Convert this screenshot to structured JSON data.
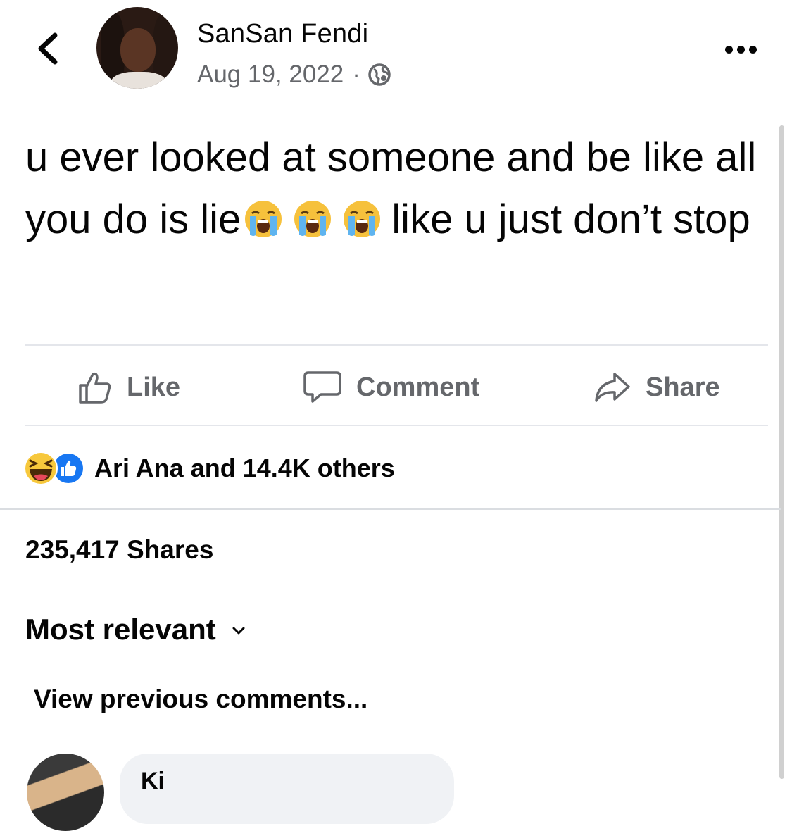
{
  "header": {
    "back_icon": "chevron-left-icon",
    "author_name": "SanSan Fendi",
    "date": "Aug 19, 2022",
    "separator": "·",
    "privacy_icon": "globe-icon",
    "more_icon": "more-horizontal-icon"
  },
  "post": {
    "text_part1": "u ever looked at someone and be like all you do is lie",
    "emojis": [
      "loudly-crying-face",
      "loudly-crying-face",
      "loudly-crying-face"
    ],
    "text_part2": "like u just don’t stop"
  },
  "actions": {
    "like_label": "Like",
    "comment_label": "Comment",
    "share_label": "Share"
  },
  "reactions": {
    "icons": [
      "haha-reaction-icon",
      "like-reaction-icon"
    ],
    "summary": "Ari Ana and 14.4K others"
  },
  "shares": {
    "count_label": "235,417 Shares"
  },
  "comments": {
    "sort_label": "Most relevant",
    "view_previous": "View previous comments...",
    "first_comment_name": "Ki"
  },
  "colors": {
    "text": "#050505",
    "secondary": "#65676b",
    "like_blue": "#1877f2",
    "divider": "#e4e6eb",
    "comment_bg": "#f0f2f5"
  }
}
